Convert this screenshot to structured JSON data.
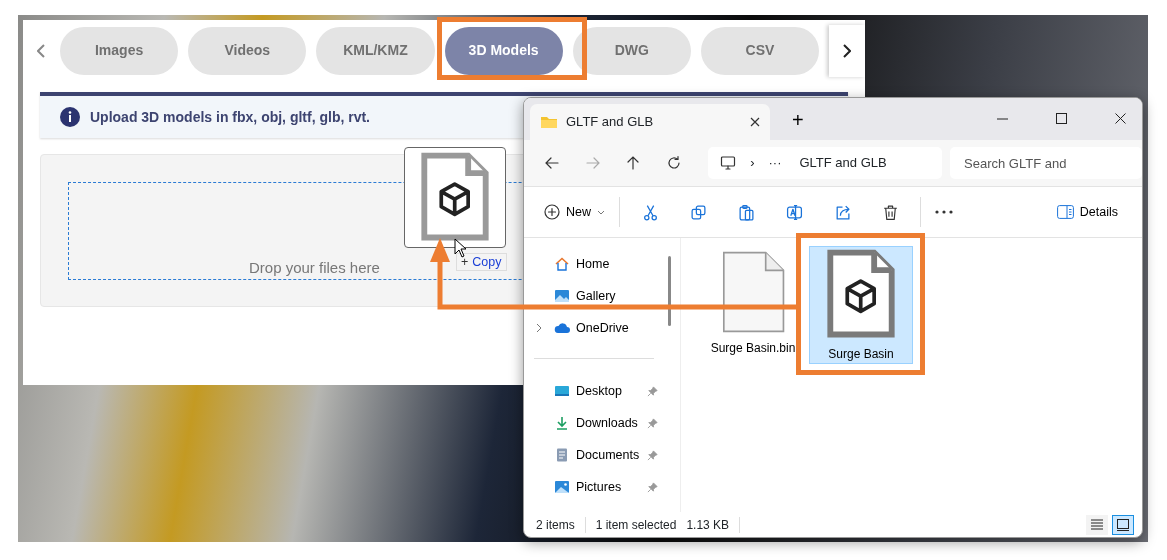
{
  "upload_panel": {
    "tabs": [
      {
        "label": "Images",
        "selected": false
      },
      {
        "label": "Videos",
        "selected": false
      },
      {
        "label": "KML/KMZ",
        "selected": false
      },
      {
        "label": "3D Models",
        "selected": true
      },
      {
        "label": "DWG",
        "selected": false
      },
      {
        "label": "CSV",
        "selected": false
      }
    ],
    "info": "Upload 3D models in fbx, obj, gltf, glb, rvt.",
    "drop_text": "Drop your files here"
  },
  "drag": {
    "badge_icon": "+",
    "badge_label": "Copy"
  },
  "explorer": {
    "tab_title": "GLTF and GLB",
    "new_tab": "+",
    "nav": [
      {
        "kind": "back",
        "disabled": false
      },
      {
        "kind": "forward",
        "disabled": true
      },
      {
        "kind": "up",
        "disabled": false
      },
      {
        "kind": "refresh",
        "disabled": false
      }
    ],
    "address": {
      "separator": "›",
      "more": "···",
      "folder": "GLTF and GLB"
    },
    "search": {
      "placeholder": "Search GLTF and"
    },
    "toolbar": {
      "new_label": "New",
      "actions": [
        {
          "kind": "cut"
        },
        {
          "kind": "copy"
        },
        {
          "kind": "paste"
        },
        {
          "kind": "rename"
        },
        {
          "kind": "share"
        },
        {
          "kind": "delete"
        }
      ],
      "details_label": "Details"
    },
    "sidebar": {
      "groups": [
        {
          "items": [
            {
              "label": "Home",
              "kind": "home",
              "pinned": false,
              "expandable": false
            },
            {
              "label": "Gallery",
              "kind": "gallery",
              "pinned": false,
              "expandable": false
            },
            {
              "label": "OneDrive",
              "kind": "cloud",
              "pinned": false,
              "expandable": true
            }
          ]
        },
        {
          "items": [
            {
              "label": "Desktop",
              "kind": "desktop",
              "pinned": true,
              "expandable": false
            },
            {
              "label": "Downloads",
              "kind": "downloads",
              "pinned": true,
              "expandable": false
            },
            {
              "label": "Documents",
              "kind": "documents",
              "pinned": true,
              "expandable": false
            },
            {
              "label": "Pictures",
              "kind": "pictures",
              "pinned": true,
              "expandable": false
            }
          ]
        }
      ]
    },
    "files": [
      {
        "name": "Surge Basin.bin",
        "kind": "blank",
        "selected": false
      },
      {
        "name": "Surge Basin",
        "kind": "model",
        "selected": true
      }
    ],
    "status_bar": {
      "count": "2 items",
      "selection": "1 item selected",
      "size": "1.13 KB"
    },
    "views": [
      {
        "kind": "list",
        "selected": false
      },
      {
        "kind": "tiles",
        "selected": true
      }
    ]
  }
}
